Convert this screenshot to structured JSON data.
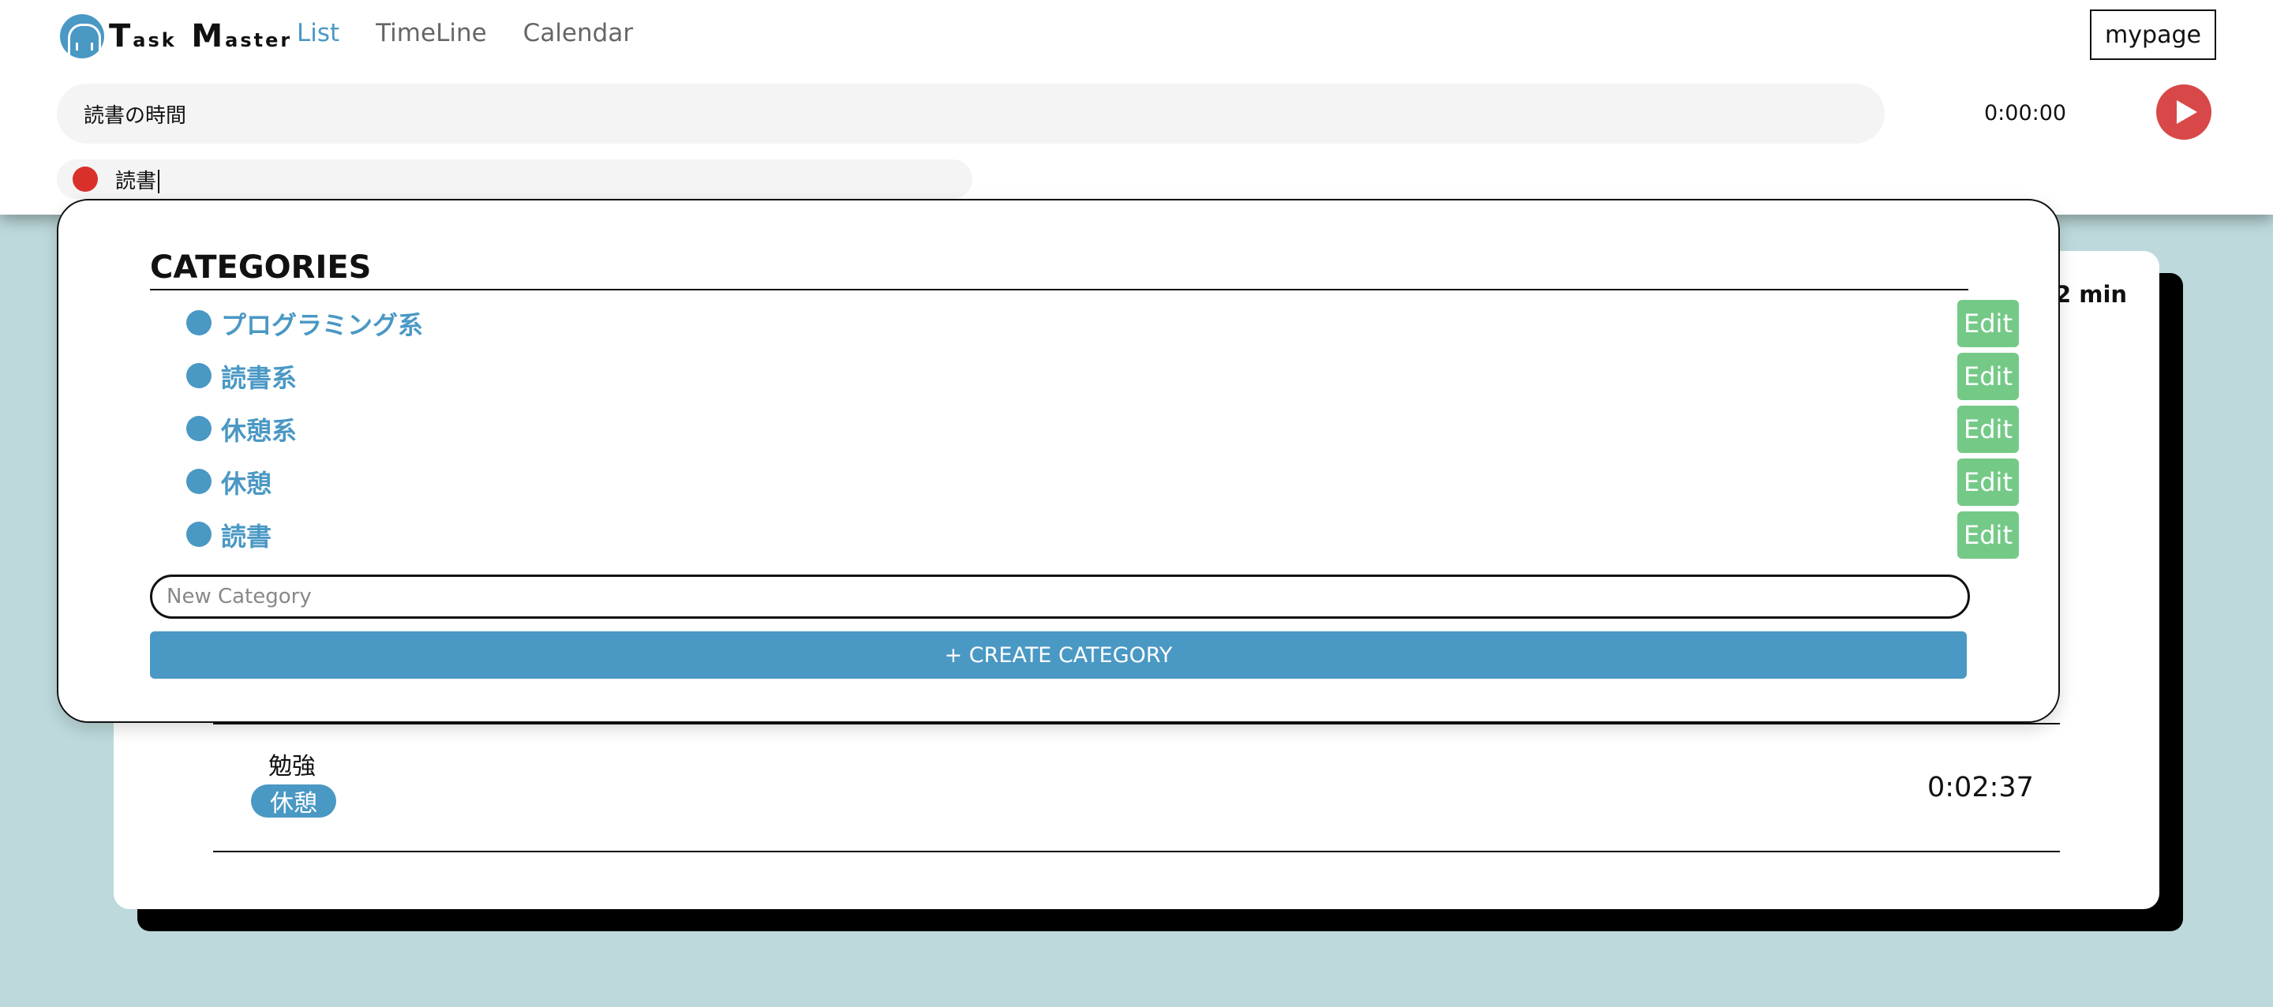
{
  "app": {
    "logo_text_1": "T",
    "logo_text_2": "ask",
    "logo_text_3": "M",
    "logo_text_4": "aster"
  },
  "nav": {
    "items": [
      {
        "label": "List",
        "active": true
      },
      {
        "label": "TimeLine",
        "active": false
      },
      {
        "label": "Calendar",
        "active": false
      }
    ]
  },
  "header": {
    "mypage_label": "mypage",
    "task_value": "読書の時間",
    "timer": "0:00:00",
    "category_value": "読書",
    "category_color": "#d9302b"
  },
  "summary": {
    "total_min_partial": "2 min"
  },
  "entry": {
    "title": "勉強",
    "tag": "休憩",
    "duration": "0:02:37"
  },
  "categories_popup": {
    "title": "CATEGORIES",
    "items": [
      {
        "name": "プログラミング系",
        "edit_label": "Edit"
      },
      {
        "name": "読書系",
        "edit_label": "Edit"
      },
      {
        "name": "休憩系",
        "edit_label": "Edit"
      },
      {
        "name": "休憩",
        "edit_label": "Edit"
      },
      {
        "name": "読書",
        "edit_label": "Edit"
      }
    ],
    "new_category_placeholder": "New Category",
    "create_button_label": "+ CREATE CATEGORY"
  },
  "colors": {
    "accent": "#4a98c4",
    "edit_green": "#74c987",
    "play_red": "#d94848",
    "background": "#bdd9db"
  },
  "icons": [
    "logo-icon",
    "play-icon",
    "category-dot-icon"
  ]
}
